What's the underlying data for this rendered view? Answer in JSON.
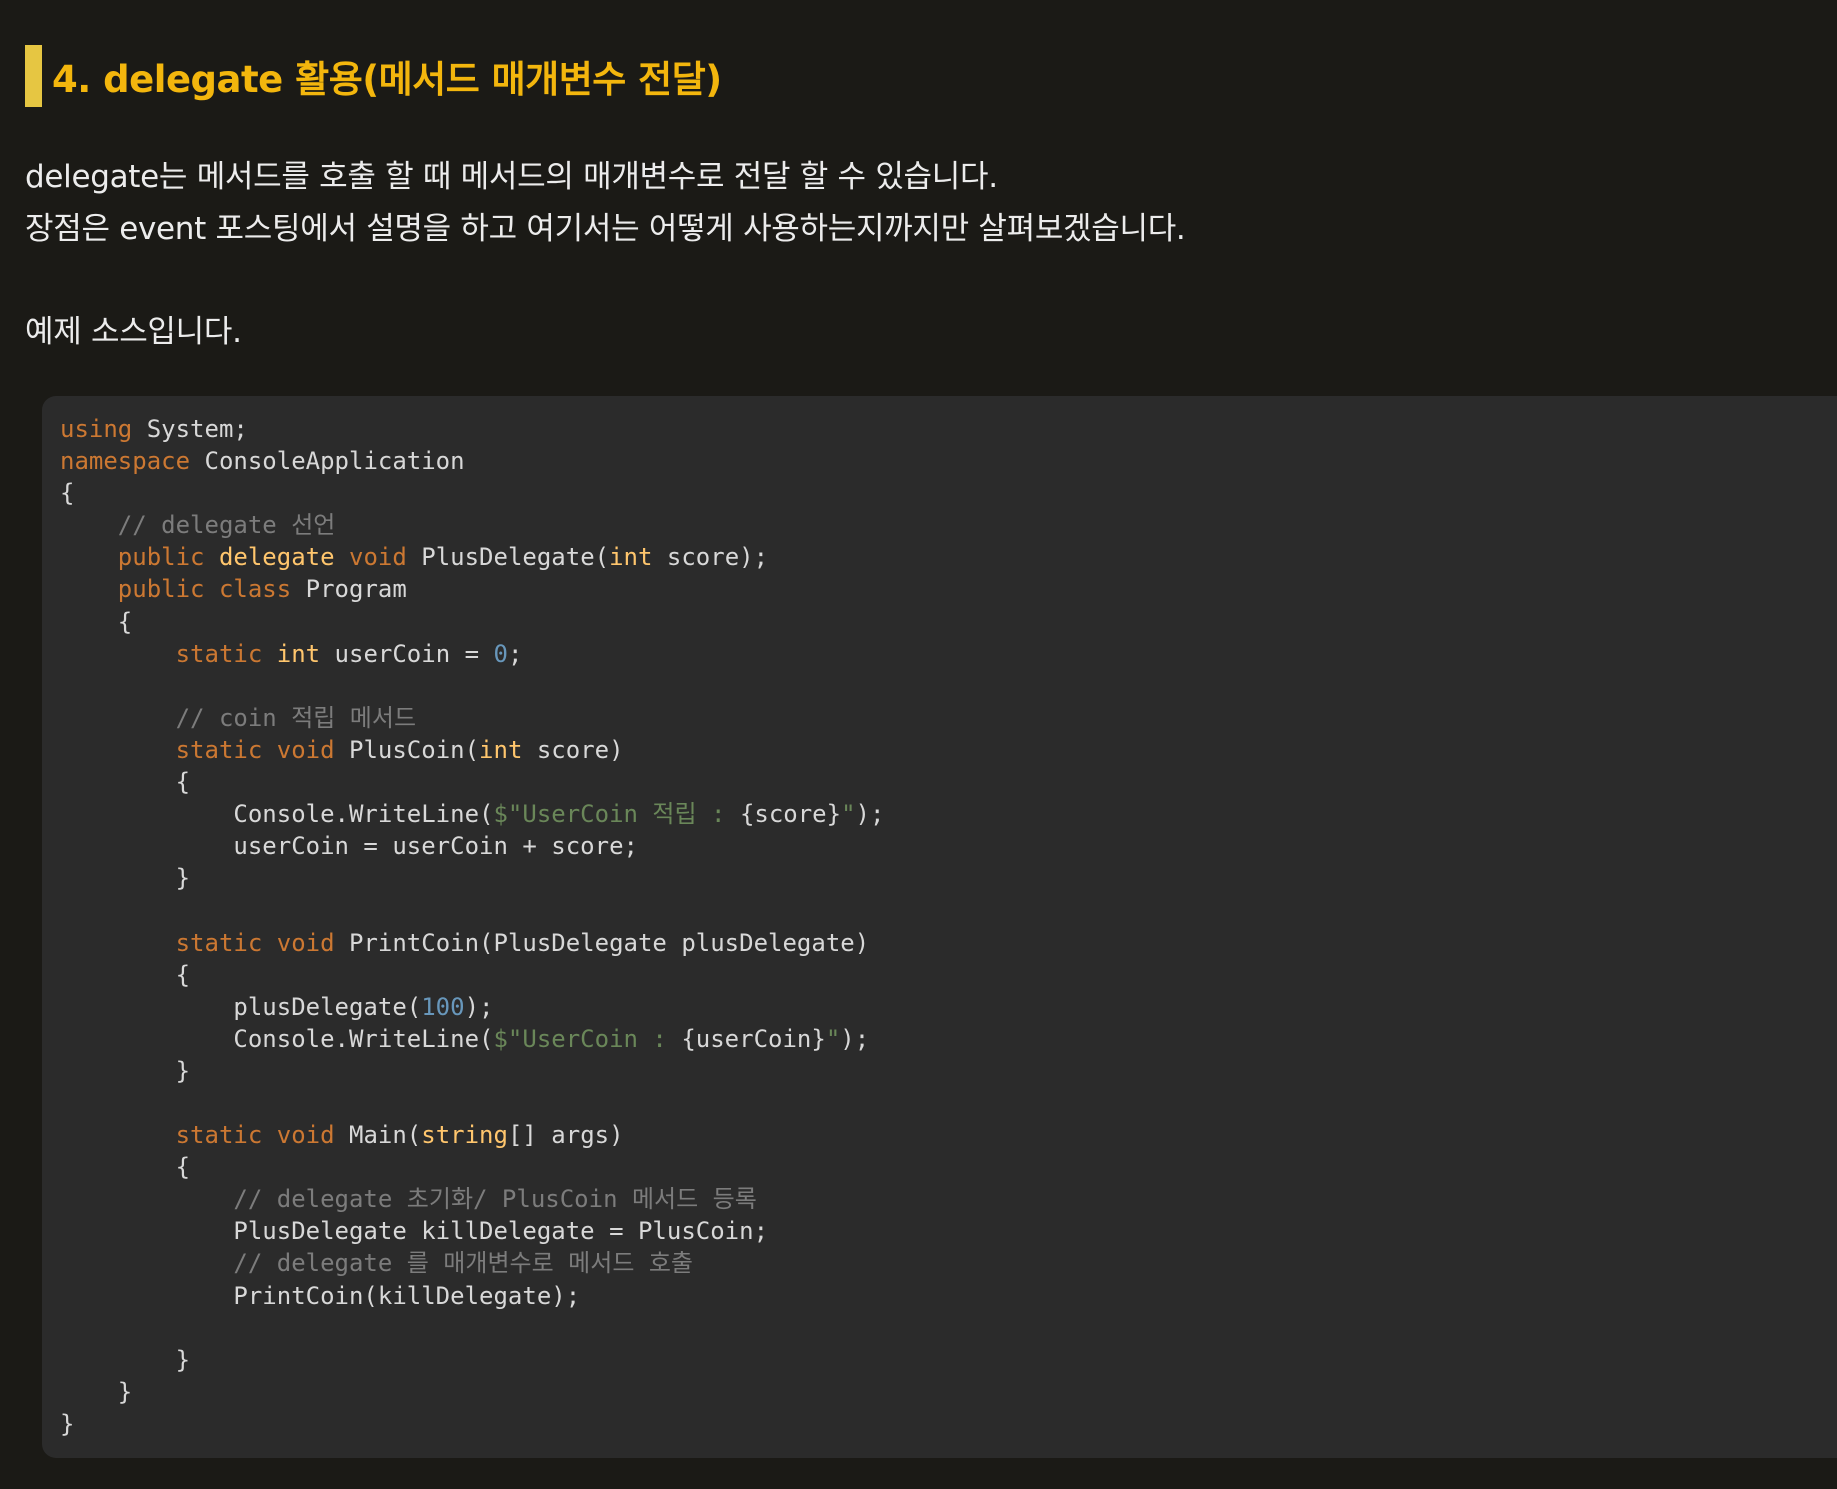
{
  "heading": {
    "title": "4. delegate 활용(메서드 매개변수 전달)"
  },
  "paragraphs": [
    "delegate는 메서드를 호출 할 때 메서드의 매개변수로 전달 할 수 있습니다.",
    "장점은 event 포스팅에서 설명을 하고 여기서는 어떻게 사용하는지까지만 살펴보겠습니다.",
    "예제 소스입니다."
  ],
  "code": {
    "language": "csharp",
    "lines": [
      [
        [
          "kw",
          "using"
        ],
        [
          "pl",
          " System;"
        ]
      ],
      [
        [
          "kw",
          "namespace"
        ],
        [
          "pl",
          " ConsoleApplication"
        ]
      ],
      [
        [
          "pl",
          "{"
        ]
      ],
      [
        [
          "cm",
          "    // delegate 선언"
        ]
      ],
      [
        [
          "pl",
          "    "
        ],
        [
          "kw",
          "public"
        ],
        [
          "pl",
          " "
        ],
        [
          "ty",
          "delegate"
        ],
        [
          "pl",
          " "
        ],
        [
          "kw",
          "void"
        ],
        [
          "pl",
          " PlusDelegate("
        ],
        [
          "ty",
          "int"
        ],
        [
          "pl",
          " score);"
        ]
      ],
      [
        [
          "pl",
          "    "
        ],
        [
          "kw",
          "public"
        ],
        [
          "pl",
          " "
        ],
        [
          "kw",
          "class"
        ],
        [
          "pl",
          " Program"
        ]
      ],
      [
        [
          "pl",
          "    {"
        ]
      ],
      [
        [
          "pl",
          "        "
        ],
        [
          "kw",
          "static"
        ],
        [
          "pl",
          " "
        ],
        [
          "ty",
          "int"
        ],
        [
          "pl",
          " userCoin = "
        ],
        [
          "nm",
          "0"
        ],
        [
          "pl",
          ";"
        ]
      ],
      [
        [
          "pl",
          ""
        ]
      ],
      [
        [
          "cm",
          "        // coin 적립 메서드"
        ]
      ],
      [
        [
          "pl",
          "        "
        ],
        [
          "kw",
          "static"
        ],
        [
          "pl",
          " "
        ],
        [
          "kw",
          "void"
        ],
        [
          "pl",
          " PlusCoin("
        ],
        [
          "ty",
          "int"
        ],
        [
          "pl",
          " score)"
        ]
      ],
      [
        [
          "pl",
          "        {"
        ]
      ],
      [
        [
          "pl",
          "            Console.WriteLine("
        ],
        [
          "st",
          "$\"UserCoin 적립 : "
        ],
        [
          "pl",
          "{score}"
        ],
        [
          "st",
          "\""
        ],
        [
          "pl",
          ");"
        ]
      ],
      [
        [
          "pl",
          "            userCoin = userCoin + score;"
        ]
      ],
      [
        [
          "pl",
          "        }"
        ]
      ],
      [
        [
          "pl",
          ""
        ]
      ],
      [
        [
          "pl",
          "        "
        ],
        [
          "kw",
          "static"
        ],
        [
          "pl",
          " "
        ],
        [
          "kw",
          "void"
        ],
        [
          "pl",
          " PrintCoin(PlusDelegate plusDelegate)"
        ]
      ],
      [
        [
          "pl",
          "        {"
        ]
      ],
      [
        [
          "pl",
          "            plusDelegate("
        ],
        [
          "nm",
          "100"
        ],
        [
          "pl",
          ");"
        ]
      ],
      [
        [
          "pl",
          "            Console.WriteLine("
        ],
        [
          "st",
          "$\"UserCoin : "
        ],
        [
          "pl",
          "{userCoin}"
        ],
        [
          "st",
          "\""
        ],
        [
          "pl",
          ");"
        ]
      ],
      [
        [
          "pl",
          "        }"
        ]
      ],
      [
        [
          "pl",
          ""
        ]
      ],
      [
        [
          "pl",
          "        "
        ],
        [
          "kw",
          "static"
        ],
        [
          "pl",
          " "
        ],
        [
          "kw",
          "void"
        ],
        [
          "pl",
          " Main("
        ],
        [
          "ty",
          "string"
        ],
        [
          "pl",
          "[] args)"
        ]
      ],
      [
        [
          "pl",
          "        {"
        ]
      ],
      [
        [
          "cm",
          "            // delegate 초기화/ PlusCoin 메서드 등록"
        ]
      ],
      [
        [
          "pl",
          "            PlusDelegate killDelegate = PlusCoin;"
        ]
      ],
      [
        [
          "cm",
          "            // delegate 를 매개변수로 메서드 호출"
        ]
      ],
      [
        [
          "pl",
          "            PrintCoin(killDelegate);"
        ]
      ],
      [
        [
          "pl",
          ""
        ]
      ],
      [
        [
          "pl",
          "        }"
        ]
      ],
      [
        [
          "pl",
          "    }"
        ]
      ],
      [
        [
          "pl",
          "}"
        ]
      ]
    ]
  },
  "colors": {
    "background": "#1b1a16",
    "heading_accent": "#e6c642",
    "heading_text": "#f3b60d",
    "code_background": "#2b2b2b",
    "keyword": "#cc7832",
    "type": "#ffc66d",
    "comment": "#7c7c7c",
    "string": "#6a8759",
    "number": "#6897bb"
  }
}
